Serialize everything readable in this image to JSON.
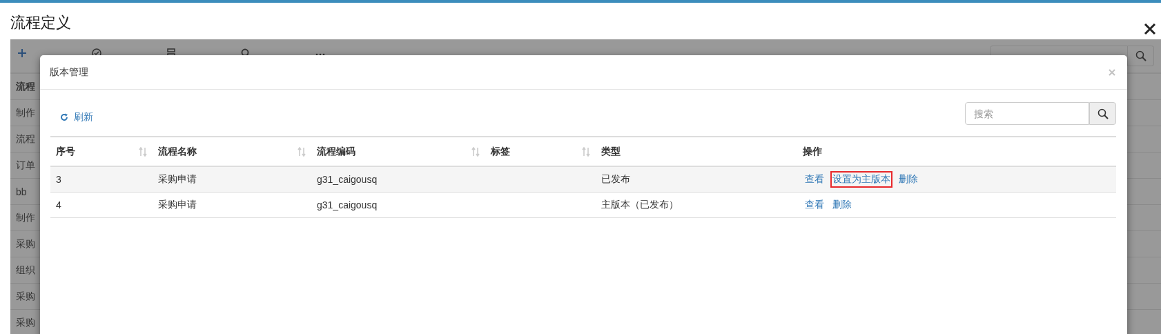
{
  "page": {
    "title": "流程定义"
  },
  "toolbar": [
    {
      "kind": "plus"
    },
    {
      "kind": "check"
    },
    {
      "kind": "stack"
    },
    {
      "kind": "search"
    },
    {
      "kind": "dots"
    }
  ],
  "list": {
    "header": "流程",
    "rows": [
      "制作",
      "流程",
      "订单",
      "bb",
      "制作",
      "采购",
      "组织",
      "采购",
      "采购"
    ]
  },
  "modal": {
    "title": "版本管理",
    "refresh": "刷新",
    "search": {
      "placeholder": "搜索"
    },
    "columns": [
      {
        "label": "序号",
        "sortable": true
      },
      {
        "label": "流程名称",
        "sortable": true
      },
      {
        "label": "流程编码",
        "sortable": true
      },
      {
        "label": "标签",
        "sortable": true
      },
      {
        "label": "类型",
        "sortable": false
      },
      {
        "label": "操作",
        "sortable": false
      }
    ],
    "rows": [
      {
        "index": "3",
        "name": "采购申请",
        "code": "g31_caigousq",
        "type": "已发布",
        "actions": [
          {
            "label": "查看",
            "highlighted": false
          },
          {
            "label": "设置为主版本",
            "highlighted": true
          },
          {
            "label": "删除",
            "highlighted": false
          }
        ]
      },
      {
        "index": "4",
        "name": "采购申请",
        "code": "g31_caigousq",
        "type": "主版本（已发布）",
        "actions": [
          {
            "label": "查看",
            "highlighted": false
          },
          {
            "label": "删除",
            "highlighted": false
          }
        ]
      }
    ]
  }
}
